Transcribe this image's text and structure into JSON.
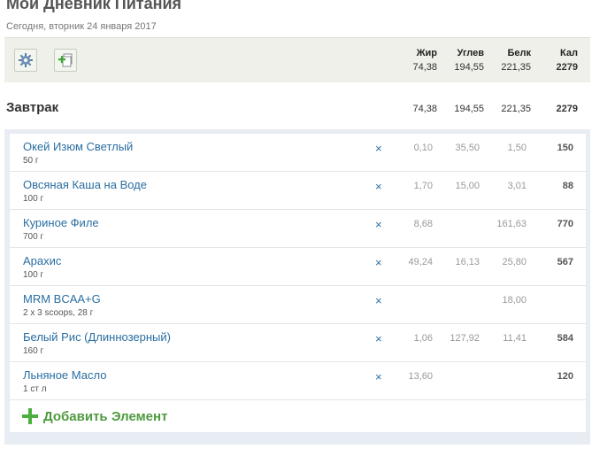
{
  "page": {
    "title": "Мой Дневник Питания",
    "date": "Сегодня, вторник 24 января 2017"
  },
  "summary": {
    "headers": {
      "fat": "Жир",
      "carbs": "Углев",
      "protein": "Белк",
      "kcal": "Кал"
    },
    "totals": {
      "fat": "74,38",
      "carbs": "194,55",
      "protein": "221,35",
      "kcal": "2279"
    }
  },
  "icons": {
    "settings": "gear-icon",
    "add_copy": "add-copy-icon"
  },
  "meal": {
    "title": "Завтрак",
    "totals": {
      "fat": "74,38",
      "carbs": "194,55",
      "protein": "221,35",
      "kcal": "2279"
    },
    "delete_symbol": "×",
    "items": [
      {
        "name": "Окей Изюм Светлый",
        "portion": "50 г",
        "fat": "0,10",
        "carbs": "35,50",
        "protein": "1,50",
        "kcal": "150"
      },
      {
        "name": "Овсяная Каша на Воде",
        "portion": "100 г",
        "fat": "1,70",
        "carbs": "15,00",
        "protein": "3,01",
        "kcal": "88"
      },
      {
        "name": "Куриное Филе",
        "portion": "700 г",
        "fat": "8,68",
        "carbs": "",
        "protein": "161,63",
        "kcal": "770"
      },
      {
        "name": "Арахис",
        "portion": "100 г",
        "fat": "49,24",
        "carbs": "16,13",
        "protein": "25,80",
        "kcal": "567"
      },
      {
        "name": "MRM BCAA+G",
        "portion": "2 x 3 scoops, 28 г",
        "fat": "",
        "carbs": "",
        "protein": "18,00",
        "kcal": ""
      },
      {
        "name": "Белый Рис (Длиннозерный)",
        "portion": "160 г",
        "fat": "1,06",
        "carbs": "127,92",
        "protein": "11,41",
        "kcal": "584"
      },
      {
        "name": "Льняное Масло",
        "portion": "1 ст л",
        "fat": "13,60",
        "carbs": "",
        "protein": "",
        "kcal": "120"
      }
    ],
    "add_label": "Добавить Элемент"
  },
  "colors": {
    "accent_link": "#2a6ea1",
    "add_green": "#4caf3e",
    "summary_bg": "#eef0e9",
    "panel_bg": "#e7edf3"
  }
}
